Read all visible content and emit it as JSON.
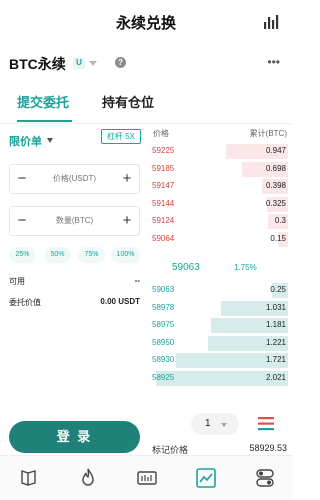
{
  "header": {
    "title": "永续兑换",
    "chart_icon": "bar-chart-icon"
  },
  "symbol_bar": {
    "symbol": "BTC永续",
    "badge": "U",
    "info_icon": "?",
    "more_icon": "•••"
  },
  "tabs": [
    {
      "label": "提交委托",
      "active": true
    },
    {
      "label": "持有仓位",
      "active": false
    }
  ],
  "order_form": {
    "order_type": "限价单",
    "leverage": "杠杆 5X",
    "price_placeholder": "价格(USDT)",
    "quantity_placeholder": "数量(BTC)",
    "percent_options": [
      "25%",
      "50%",
      "75%",
      "100%"
    ],
    "available_label": "可用",
    "available_value": "--",
    "order_value_label": "委托价值",
    "order_value": "0.00 USDT",
    "login_label": "登 录"
  },
  "order_book": {
    "headers": {
      "price": "价格",
      "cumulative": "累计(BTC)"
    },
    "asks": [
      {
        "price": "59225",
        "qty": "0.947",
        "depth": 0.947
      },
      {
        "price": "59185",
        "qty": "0.698",
        "depth": 0.698
      },
      {
        "price": "59147",
        "qty": "0.398",
        "depth": 0.398
      },
      {
        "price": "59144",
        "qty": "0.325",
        "depth": 0.325
      },
      {
        "price": "59124",
        "qty": "0.3",
        "depth": 0.3
      },
      {
        "price": "59064",
        "qty": "0.15",
        "depth": 0.15
      }
    ],
    "last_price": "59063",
    "change": "1.75%",
    "bids": [
      {
        "price": "59063",
        "qty": "0.25",
        "depth": 0.25
      },
      {
        "price": "58978",
        "qty": "1.031",
        "depth": 1.031
      },
      {
        "price": "58975",
        "qty": "1.181",
        "depth": 1.181
      },
      {
        "price": "58950",
        "qty": "1.221",
        "depth": 1.221
      },
      {
        "price": "58930",
        "qty": "1.721",
        "depth": 1.721
      },
      {
        "price": "58925",
        "qty": "2.021",
        "depth": 2.021
      }
    ],
    "depth_value": "1",
    "mark_label": "标记价格",
    "mark_price": "58929.53"
  },
  "colors": {
    "accent": "#1aa39b",
    "ask": "#d9423d",
    "login": "#1f8178"
  },
  "nav": [
    {
      "name": "nav-book-icon"
    },
    {
      "name": "nav-fire-icon"
    },
    {
      "name": "nav-ticker-icon"
    },
    {
      "name": "nav-trade-chart-icon"
    },
    {
      "name": "nav-toggle-icon"
    }
  ]
}
